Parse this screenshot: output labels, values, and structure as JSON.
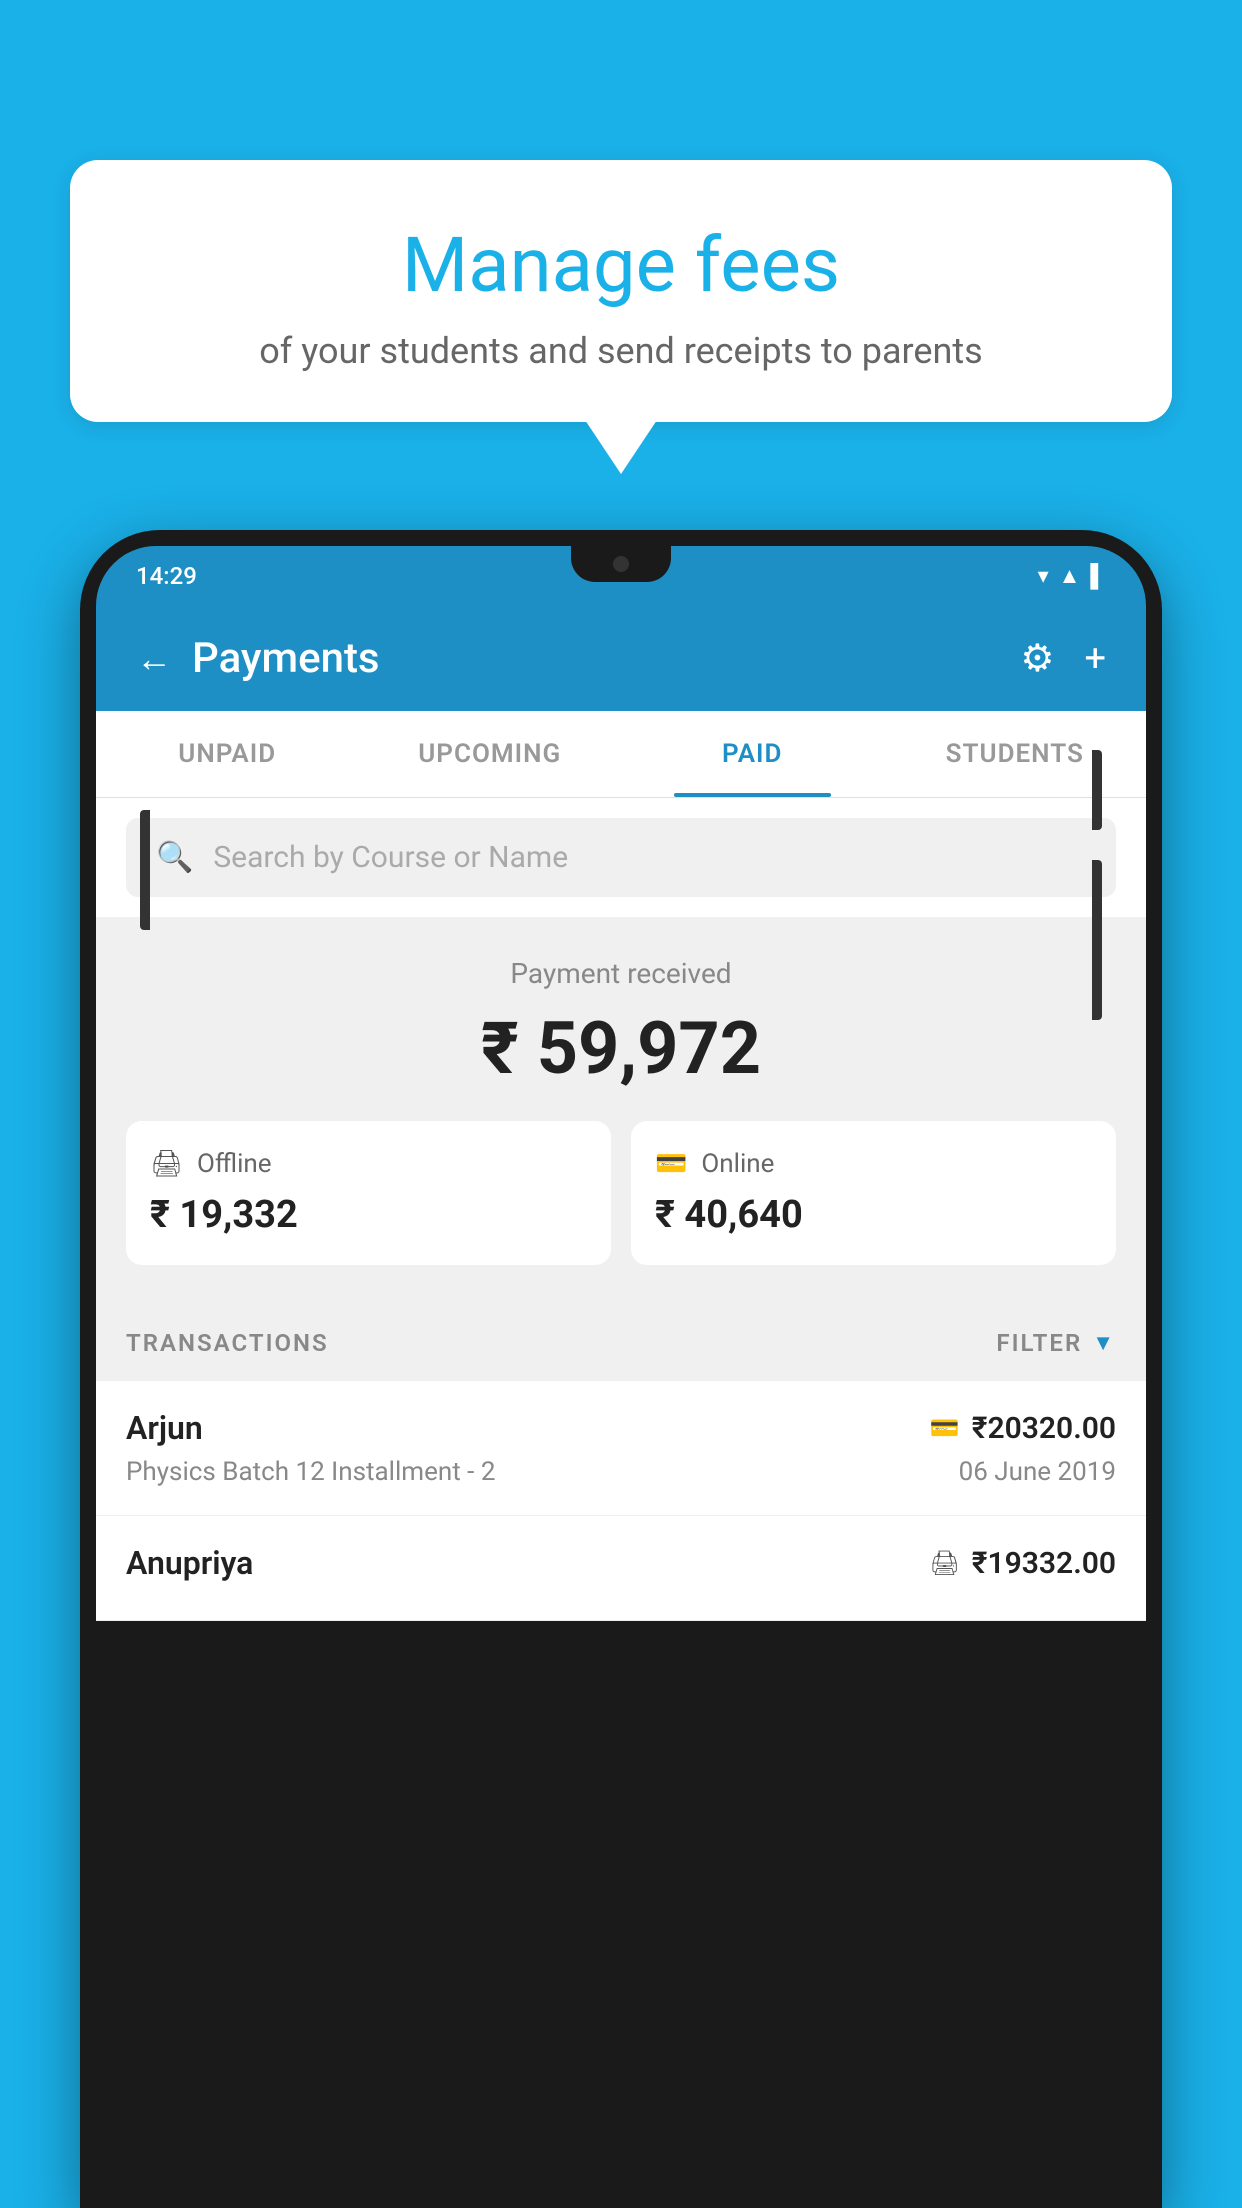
{
  "background_color": "#1ab0e8",
  "speech_bubble": {
    "title": "Manage fees",
    "subtitle": "of your students and send receipts to parents"
  },
  "phone": {
    "status_bar": {
      "time": "14:29",
      "wifi": "▾",
      "signal": "▾",
      "battery": "▌"
    },
    "header": {
      "back_label": "←",
      "title": "Payments",
      "settings_icon": "⚙",
      "add_icon": "+"
    },
    "tabs": [
      {
        "label": "UNPAID",
        "active": false
      },
      {
        "label": "UPCOMING",
        "active": false
      },
      {
        "label": "PAID",
        "active": true
      },
      {
        "label": "STUDENTS",
        "active": false
      }
    ],
    "search": {
      "placeholder": "Search by Course or Name"
    },
    "payment_summary": {
      "received_label": "Payment received",
      "total_amount": "₹ 59,972",
      "offline": {
        "label": "Offline",
        "amount": "₹ 19,332"
      },
      "online": {
        "label": "Online",
        "amount": "₹ 40,640"
      }
    },
    "transactions": {
      "section_label": "TRANSACTIONS",
      "filter_label": "FILTER",
      "items": [
        {
          "name": "Arjun",
          "detail": "Physics Batch 12 Installment - 2",
          "amount": "₹20320.00",
          "date": "06 June 2019",
          "type": "online"
        },
        {
          "name": "Anupriya",
          "detail": "",
          "amount": "₹19332.00",
          "date": "",
          "type": "offline"
        }
      ]
    }
  }
}
